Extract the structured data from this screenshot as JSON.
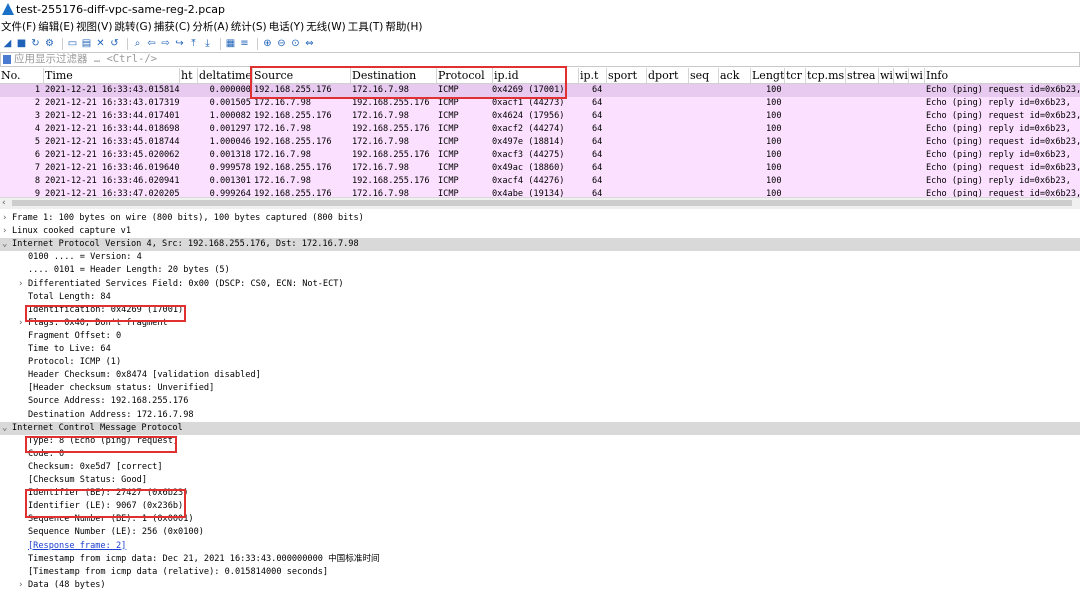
{
  "window": {
    "title": "test-255176-diff-vpc-same-reg-2.pcap"
  },
  "menu": [
    "文件(F)",
    "编辑(E)",
    "视图(V)",
    "跳转(G)",
    "捕获(C)",
    "分析(A)",
    "统计(S)",
    "电话(Y)",
    "无线(W)",
    "工具(T)",
    "帮助(H)"
  ],
  "toolbar_icons": [
    "shark-fin-start-icon",
    "stop-square-icon",
    "restart-icon",
    "gear-options-icon",
    "open-folder-icon",
    "save-file-icon",
    "close-file-icon",
    "reload-icon",
    "search-icon",
    "back-arrow-icon",
    "forward-arrow-icon",
    "goto-packet-icon",
    "first-packet-icon",
    "last-packet-icon",
    "autoscroll-icon",
    "colorize-icon",
    "zoom-in-icon",
    "zoom-out-icon",
    "zoom-reset-icon",
    "resize-columns-icon"
  ],
  "filter": {
    "placeholder": "应用显示过滤器 … <Ctrl-/>"
  },
  "columns": [
    "No.",
    "Time",
    "ht",
    "deltatime",
    "Source",
    "Destination",
    "Protocol",
    "ip.id",
    "ip.t",
    "sport",
    "dport",
    "seq",
    "ack",
    "Lengt",
    "tcr",
    "tcp.ms",
    "strea",
    "wi",
    "wi",
    "wi",
    "Info"
  ],
  "packets": [
    {
      "no": "1",
      "time": "2021-12-21 16:33:43.015814",
      "delta": "0.000000",
      "src": "192.168.255.176",
      "dst": "172.16.7.98",
      "proto": "ICMP",
      "ipid": "0x4269 (17001)",
      "ttl": "64",
      "len": "100",
      "info": "Echo (ping) request  id=0x6b23,"
    },
    {
      "no": "2",
      "time": "2021-12-21 16:33:43.017319",
      "delta": "0.001505",
      "src": "172.16.7.98",
      "dst": "192.168.255.176",
      "proto": "ICMP",
      "ipid": "0xacf1 (44273)",
      "ttl": "64",
      "len": "100",
      "info": "Echo (ping) reply    id=0x6b23,"
    },
    {
      "no": "3",
      "time": "2021-12-21 16:33:44.017401",
      "delta": "1.000082",
      "src": "192.168.255.176",
      "dst": "172.16.7.98",
      "proto": "ICMP",
      "ipid": "0x4624 (17956)",
      "ttl": "64",
      "len": "100",
      "info": "Echo (ping) request  id=0x6b23,"
    },
    {
      "no": "4",
      "time": "2021-12-21 16:33:44.018698",
      "delta": "0.001297",
      "src": "172.16.7.98",
      "dst": "192.168.255.176",
      "proto": "ICMP",
      "ipid": "0xacf2 (44274)",
      "ttl": "64",
      "len": "100",
      "info": "Echo (ping) reply    id=0x6b23,"
    },
    {
      "no": "5",
      "time": "2021-12-21 16:33:45.018744",
      "delta": "1.000046",
      "src": "192.168.255.176",
      "dst": "172.16.7.98",
      "proto": "ICMP",
      "ipid": "0x497e (18814)",
      "ttl": "64",
      "len": "100",
      "info": "Echo (ping) request  id=0x6b23,"
    },
    {
      "no": "6",
      "time": "2021-12-21 16:33:45.020062",
      "delta": "0.001318",
      "src": "172.16.7.98",
      "dst": "192.168.255.176",
      "proto": "ICMP",
      "ipid": "0xacf3 (44275)",
      "ttl": "64",
      "len": "100",
      "info": "Echo (ping) reply    id=0x6b23,"
    },
    {
      "no": "7",
      "time": "2021-12-21 16:33:46.019640",
      "delta": "0.999578",
      "src": "192.168.255.176",
      "dst": "172.16.7.98",
      "proto": "ICMP",
      "ipid": "0x49ac (18860)",
      "ttl": "64",
      "len": "100",
      "info": "Echo (ping) request  id=0x6b23,"
    },
    {
      "no": "8",
      "time": "2021-12-21 16:33:46.020941",
      "delta": "0.001301",
      "src": "172.16.7.98",
      "dst": "192.168.255.176",
      "proto": "ICMP",
      "ipid": "0xacf4 (44276)",
      "ttl": "64",
      "len": "100",
      "info": "Echo (ping) reply    id=0x6b23,"
    },
    {
      "no": "9",
      "time": "2021-12-21 16:33:47.020205",
      "delta": "0.999264",
      "src": "192.168.255.176",
      "dst": "172.16.7.98",
      "proto": "ICMP",
      "ipid": "0x4abe (19134)",
      "ttl": "64",
      "len": "100",
      "info": "Echo (ping) request  id=0x6b23,"
    }
  ],
  "details": [
    {
      "text": "Frame 1: 100 bytes on wire (800 bits), 100 bytes captured (800 bits)",
      "arrow": "›",
      "indent": 0
    },
    {
      "text": "Linux cooked capture v1",
      "arrow": "›",
      "indent": 0
    },
    {
      "text": "Internet Protocol Version 4, Src: 192.168.255.176, Dst: 172.16.7.98",
      "arrow": "⌄",
      "indent": 0,
      "hi": true
    },
    {
      "text": "0100 .... = Version: 4",
      "arrow": "",
      "indent": 1
    },
    {
      "text": ".... 0101 = Header Length: 20 bytes (5)",
      "arrow": "",
      "indent": 1
    },
    {
      "text": "Differentiated Services Field: 0x00 (DSCP: CS0, ECN: Not-ECT)",
      "arrow": "›",
      "indent": 1
    },
    {
      "text": "Total Length: 84",
      "arrow": "",
      "indent": 1
    },
    {
      "text": "Identification: 0x4269 (17001)",
      "arrow": "",
      "indent": 1
    },
    {
      "text": "Flags: 0x40, Don't fragment",
      "arrow": "›",
      "indent": 1
    },
    {
      "text": "Fragment Offset: 0",
      "arrow": "",
      "indent": 1
    },
    {
      "text": "Time to Live: 64",
      "arrow": "",
      "indent": 1
    },
    {
      "text": "Protocol: ICMP (1)",
      "arrow": "",
      "indent": 1
    },
    {
      "text": "Header Checksum: 0x8474 [validation disabled]",
      "arrow": "",
      "indent": 1
    },
    {
      "text": "[Header checksum status: Unverified]",
      "arrow": "",
      "indent": 1
    },
    {
      "text": "Source Address: 192.168.255.176",
      "arrow": "",
      "indent": 1
    },
    {
      "text": "Destination Address: 172.16.7.98",
      "arrow": "",
      "indent": 1
    },
    {
      "text": "Internet Control Message Protocol",
      "arrow": "⌄",
      "indent": 0,
      "hi": true
    },
    {
      "text": "Type: 8 (Echo (ping) request)",
      "arrow": "",
      "indent": 1
    },
    {
      "text": "Code: 0",
      "arrow": "",
      "indent": 1
    },
    {
      "text": "Checksum: 0xe5d7 [correct]",
      "arrow": "",
      "indent": 1
    },
    {
      "text": "[Checksum Status: Good]",
      "arrow": "",
      "indent": 1
    },
    {
      "text": "Identifier (BE): 27427 (0x6b23)",
      "arrow": "",
      "indent": 1
    },
    {
      "text": "Identifier (LE): 9067 (0x236b)",
      "arrow": "",
      "indent": 1
    },
    {
      "text": "Sequence Number (BE): 1 (0x0001)",
      "arrow": "",
      "indent": 1
    },
    {
      "text": "Sequence Number (LE): 256 (0x0100)",
      "arrow": "",
      "indent": 1
    },
    {
      "text": "[Response frame: 2]",
      "arrow": "",
      "indent": 1,
      "link": true
    },
    {
      "text": "Timestamp from icmp data: Dec 21, 2021 16:33:43.000000000 中国标准时间",
      "arrow": "",
      "indent": 1
    },
    {
      "text": "[Timestamp from icmp data (relative): 0.015814000 seconds]",
      "arrow": "",
      "indent": 1
    },
    {
      "text": "Data (48 bytes)",
      "arrow": "›",
      "indent": 1
    }
  ]
}
